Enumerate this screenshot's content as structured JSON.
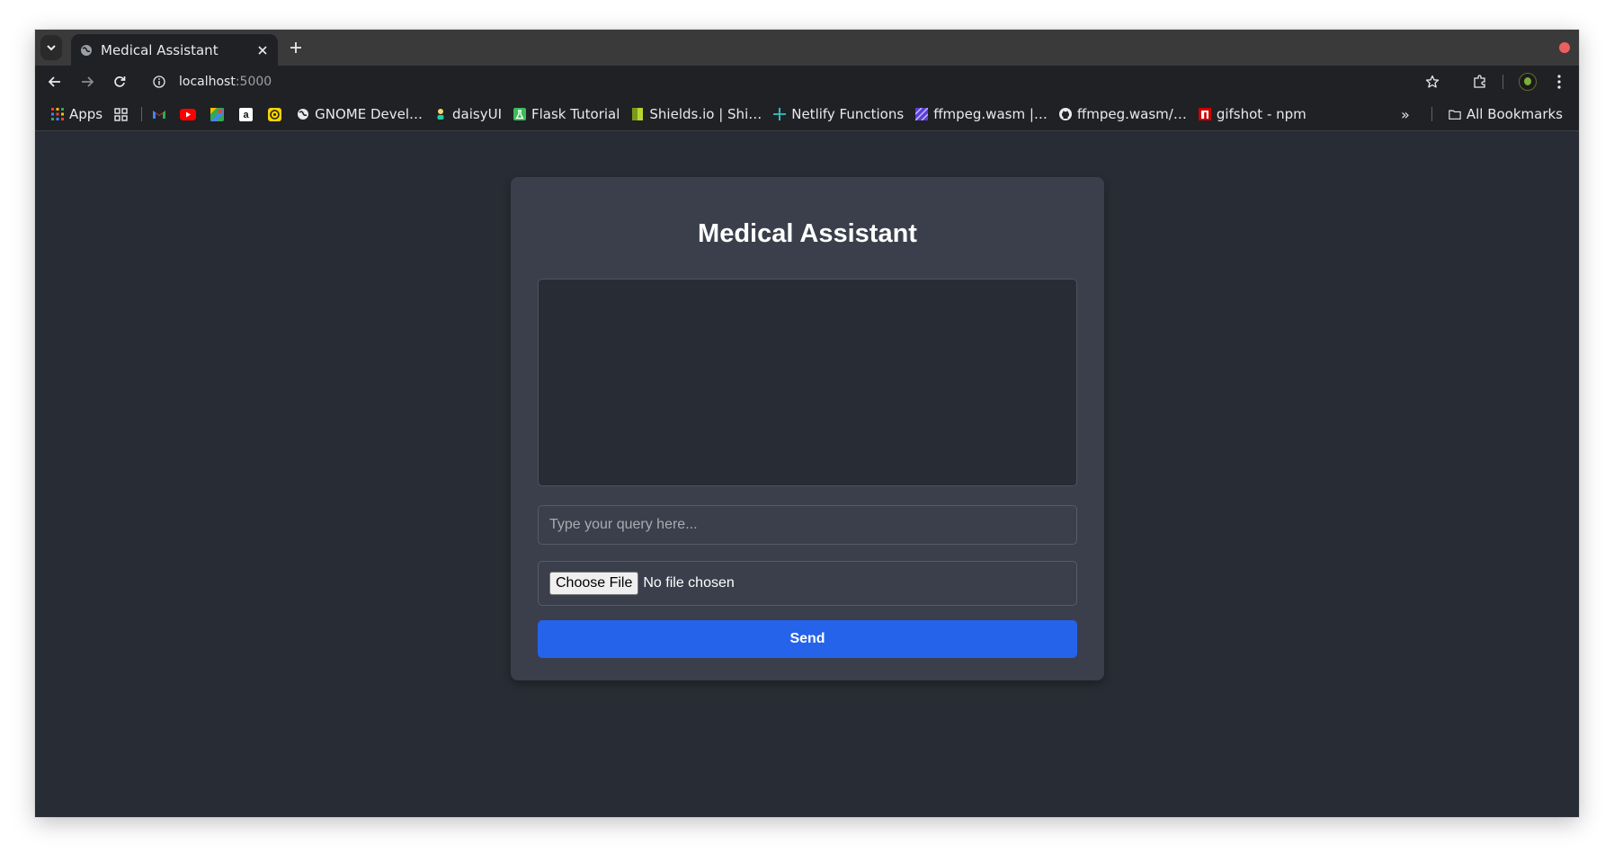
{
  "browser": {
    "tab": {
      "title": "Medical Assistant",
      "favicon": "globe-icon"
    },
    "url": {
      "host": "localhost",
      "port": ":5000"
    },
    "window_control_color": "#ed5f5f",
    "bookmarks": [
      {
        "label": "Apps",
        "icon": "apps-grid-icon"
      },
      {
        "label": "",
        "icon": "tab-groups-icon"
      },
      {
        "label": "",
        "icon": "gmail-icon"
      },
      {
        "label": "",
        "icon": "youtube-icon"
      },
      {
        "label": "",
        "icon": "maps-icon"
      },
      {
        "label": "",
        "icon": "amazon-icon"
      },
      {
        "label": "",
        "icon": "yellow-app-icon"
      },
      {
        "label": "GNOME Devel…",
        "icon": "globe-icon"
      },
      {
        "label": "daisyUI",
        "icon": "daisyui-icon"
      },
      {
        "label": "Flask Tutorial",
        "icon": "flask-icon"
      },
      {
        "label": "Shields.io | Shi…",
        "icon": "shields-icon"
      },
      {
        "label": "Netlify Functions",
        "icon": "netlify-icon"
      },
      {
        "label": "ffmpeg.wasm |…",
        "icon": "ffmpeg-icon"
      },
      {
        "label": "ffmpeg.wasm/…",
        "icon": "github-icon"
      },
      {
        "label": "gifshot - npm",
        "icon": "npm-icon"
      }
    ],
    "overflow_label": "»",
    "all_bookmarks_label": "All Bookmarks"
  },
  "app": {
    "title": "Medical Assistant",
    "query_placeholder": "Type your query here...",
    "choose_file_label": "Choose File",
    "file_status": "No file chosen",
    "send_label": "Send",
    "accent_color": "#2563eb",
    "page_background": "#282c34",
    "card_background": "#3a3f4b"
  }
}
